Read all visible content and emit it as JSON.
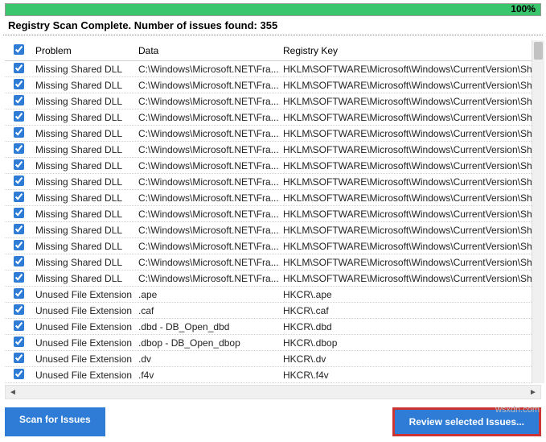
{
  "progress": {
    "percent_label": "100%"
  },
  "status": "Registry Scan Complete. Number of issues found: 355",
  "headers": {
    "problem": "Problem",
    "data": "Data",
    "key": "Registry Key"
  },
  "rows": [
    {
      "checked": true,
      "problem": "Missing Shared DLL",
      "data": "C:\\Windows\\Microsoft.NET\\Fra...",
      "key": "HKLM\\SOFTWARE\\Microsoft\\Windows\\CurrentVersion\\Shared"
    },
    {
      "checked": true,
      "problem": "Missing Shared DLL",
      "data": "C:\\Windows\\Microsoft.NET\\Fra...",
      "key": "HKLM\\SOFTWARE\\Microsoft\\Windows\\CurrentVersion\\Shared"
    },
    {
      "checked": true,
      "problem": "Missing Shared DLL",
      "data": "C:\\Windows\\Microsoft.NET\\Fra...",
      "key": "HKLM\\SOFTWARE\\Microsoft\\Windows\\CurrentVersion\\Shared"
    },
    {
      "checked": true,
      "problem": "Missing Shared DLL",
      "data": "C:\\Windows\\Microsoft.NET\\Fra...",
      "key": "HKLM\\SOFTWARE\\Microsoft\\Windows\\CurrentVersion\\Shared"
    },
    {
      "checked": true,
      "problem": "Missing Shared DLL",
      "data": "C:\\Windows\\Microsoft.NET\\Fra...",
      "key": "HKLM\\SOFTWARE\\Microsoft\\Windows\\CurrentVersion\\Shared"
    },
    {
      "checked": true,
      "problem": "Missing Shared DLL",
      "data": "C:\\Windows\\Microsoft.NET\\Fra...",
      "key": "HKLM\\SOFTWARE\\Microsoft\\Windows\\CurrentVersion\\Shared"
    },
    {
      "checked": true,
      "problem": "Missing Shared DLL",
      "data": "C:\\Windows\\Microsoft.NET\\Fra...",
      "key": "HKLM\\SOFTWARE\\Microsoft\\Windows\\CurrentVersion\\Shared"
    },
    {
      "checked": true,
      "problem": "Missing Shared DLL",
      "data": "C:\\Windows\\Microsoft.NET\\Fra...",
      "key": "HKLM\\SOFTWARE\\Microsoft\\Windows\\CurrentVersion\\Shared"
    },
    {
      "checked": true,
      "problem": "Missing Shared DLL",
      "data": "C:\\Windows\\Microsoft.NET\\Fra...",
      "key": "HKLM\\SOFTWARE\\Microsoft\\Windows\\CurrentVersion\\Shared"
    },
    {
      "checked": true,
      "problem": "Missing Shared DLL",
      "data": "C:\\Windows\\Microsoft.NET\\Fra...",
      "key": "HKLM\\SOFTWARE\\Microsoft\\Windows\\CurrentVersion\\Shared"
    },
    {
      "checked": true,
      "problem": "Missing Shared DLL",
      "data": "C:\\Windows\\Microsoft.NET\\Fra...",
      "key": "HKLM\\SOFTWARE\\Microsoft\\Windows\\CurrentVersion\\Shared"
    },
    {
      "checked": true,
      "problem": "Missing Shared DLL",
      "data": "C:\\Windows\\Microsoft.NET\\Fra...",
      "key": "HKLM\\SOFTWARE\\Microsoft\\Windows\\CurrentVersion\\Shared"
    },
    {
      "checked": true,
      "problem": "Missing Shared DLL",
      "data": "C:\\Windows\\Microsoft.NET\\Fra...",
      "key": "HKLM\\SOFTWARE\\Microsoft\\Windows\\CurrentVersion\\Shared"
    },
    {
      "checked": true,
      "problem": "Missing Shared DLL",
      "data": "C:\\Windows\\Microsoft.NET\\Fra...",
      "key": "HKLM\\SOFTWARE\\Microsoft\\Windows\\CurrentVersion\\Shared"
    },
    {
      "checked": true,
      "problem": "Unused File Extension",
      "data": ".ape",
      "key": "HKCR\\.ape"
    },
    {
      "checked": true,
      "problem": "Unused File Extension",
      "data": ".caf",
      "key": "HKCR\\.caf"
    },
    {
      "checked": true,
      "problem": "Unused File Extension",
      "data": ".dbd - DB_Open_dbd",
      "key": "HKCR\\.dbd"
    },
    {
      "checked": true,
      "problem": "Unused File Extension",
      "data": ".dbop - DB_Open_dbop",
      "key": "HKCR\\.dbop"
    },
    {
      "checked": true,
      "problem": "Unused File Extension",
      "data": ".dv",
      "key": "HKCR\\.dv"
    },
    {
      "checked": true,
      "problem": "Unused File Extension",
      "data": ".f4v",
      "key": "HKCR\\.f4v"
    }
  ],
  "buttons": {
    "scan": "Scan for Issues",
    "review": "Review selected Issues..."
  },
  "watermark": "wsxdn.com"
}
